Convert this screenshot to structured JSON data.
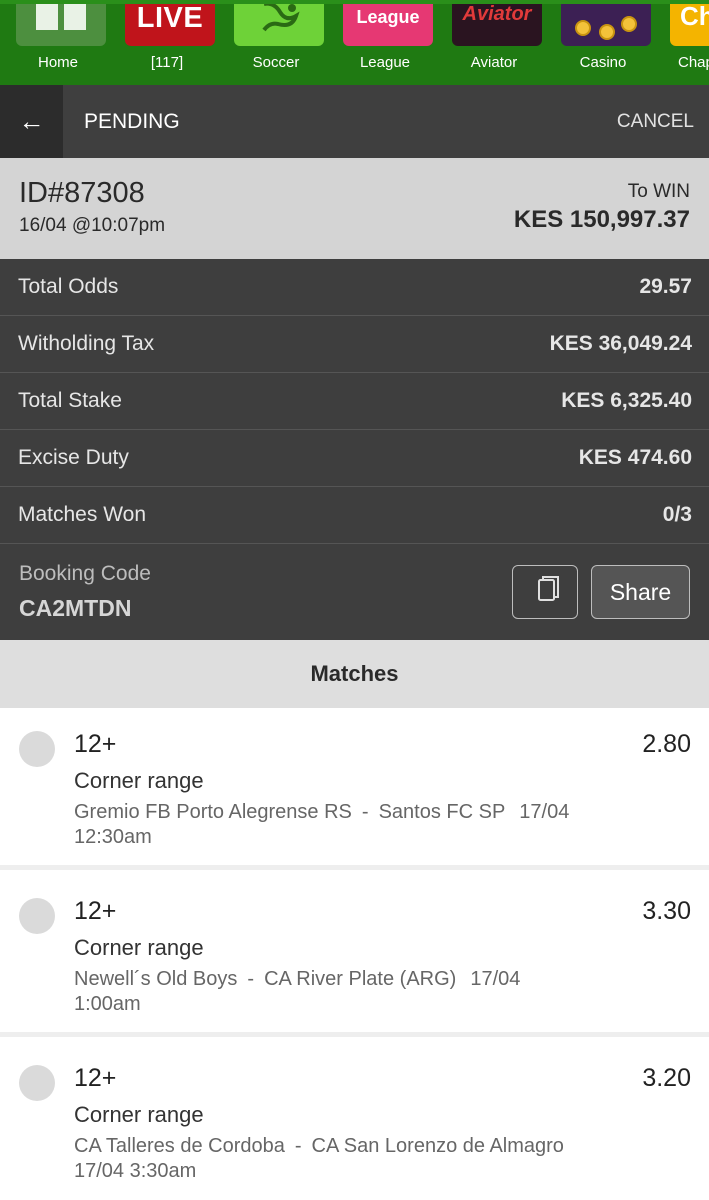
{
  "nav": {
    "items": [
      {
        "label": "Home",
        "icon": "home-icon",
        "tile_text": ""
      },
      {
        "label": "[117]",
        "icon": "live-icon",
        "tile_text": "LIVE"
      },
      {
        "label": "Soccer",
        "icon": "soccer-player-icon",
        "tile_text": ""
      },
      {
        "label": "League",
        "icon": "league-icon",
        "tile_text": "League"
      },
      {
        "label": "Aviator",
        "icon": "aviator-icon",
        "tile_text": "Aviator"
      },
      {
        "label": "Casino",
        "icon": "casino-coins-icon",
        "tile_text": ""
      },
      {
        "label": "Chap",
        "icon": "chap-icon",
        "tile_text": "Ch"
      }
    ]
  },
  "header": {
    "back_icon": "arrow-left-icon",
    "back_glyph": "←",
    "title": "PENDING",
    "cancel_label": "CANCEL"
  },
  "summary": {
    "bet_id": "ID#87308",
    "date": "16/04 @10:07pm",
    "to_win_label": "To WIN",
    "to_win_amount": "KES 150,997.37"
  },
  "details": [
    {
      "label": "Total Odds",
      "value": "29.57"
    },
    {
      "label": "Witholding Tax",
      "value": "KES 36,049.24"
    },
    {
      "label": "Total Stake",
      "value": "KES 6,325.40"
    },
    {
      "label": "Excise Duty",
      "value": "KES 474.60"
    },
    {
      "label": "Matches Won",
      "value": "0/3"
    }
  ],
  "booking": {
    "label": "Booking Code",
    "code": "CA2MTDN",
    "copy_icon": "copy-icon",
    "share_label": "Share"
  },
  "matches_title": "Matches",
  "matches": [
    {
      "pick": "12+",
      "market": "Corner range",
      "odds": "2.80",
      "home": "Gremio FB Porto Alegrense RS",
      "sep": "-",
      "away": "Santos FC SP",
      "date": "17/04",
      "time": "12:30am"
    },
    {
      "pick": "12+",
      "market": "Corner range",
      "odds": "3.30",
      "home": "Newell´s Old Boys",
      "sep": "-",
      "away": "CA River Plate (ARG)",
      "date": "17/04",
      "time": "1:00am"
    },
    {
      "pick": "12+",
      "market": "Corner range",
      "odds": "3.20",
      "home": "CA Talleres de Cordoba",
      "sep": "-",
      "away": "CA San Lorenzo de Almagro",
      "date": "17/04",
      "time": "3:30am"
    }
  ],
  "colors": {
    "nav_bg": "#1f7a12",
    "header_bg": "#3f3f3f",
    "summary_bg": "#d4d4d4",
    "details_bg": "#3e3e3e"
  }
}
